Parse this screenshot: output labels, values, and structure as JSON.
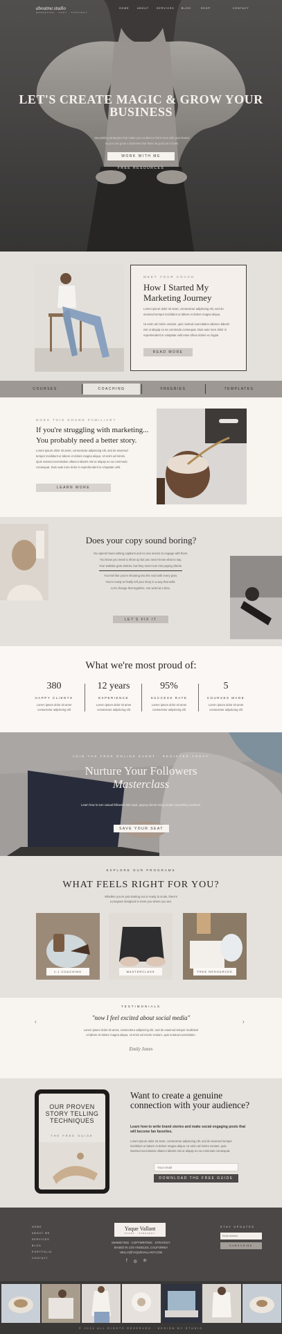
{
  "nav": {
    "brand": "aboutme.studio",
    "brand_sub": "MARKETING · COPY · STRATEGY",
    "items": [
      "HOME",
      "ABOUT",
      "SERVICES",
      "BLOG",
      "SHOP",
      "CONTACT"
    ]
  },
  "hero": {
    "title": "LET'S CREATE MAGIC & GROW YOUR BUSINESS",
    "lines": [
      "Storytelling strategies that make your audience fall in love with your brand,",
      "so you can grow a business that feels as good as it looks."
    ],
    "button_primary": "WORK WITH ME",
    "button_secondary": "FREE RESOURCES"
  },
  "story": {
    "eyebrow": "MEET YOUR COACH",
    "title": "How I Started My Marketing Journey",
    "para1": [
      "Lorem ipsum dolor sit amet, consectetur adipiscing elit, sed do",
      "eiusmod tempor incididunt ut labore et dolore magna aliqua."
    ],
    "para2": [
      "Ut enim ad minim veniam, quis nostrud exercitation ullamco laboris",
      "nisi ut aliquip ex ea commodo consequat. Duis aute irure dolor in",
      "reprehenderit in voluptate velit esse cillum dolore eu fugiat."
    ],
    "button": "READ MORE"
  },
  "barnav": {
    "tabs": [
      "COURSES",
      "COACHING",
      "FREEBIES",
      "TEMPLATES"
    ]
  },
  "struggle": {
    "eyebrow": "DOES THIS SOUND FAMILIAR?",
    "title_line1": "If you're struggling with marketing...",
    "title_line2": "You probably need a better story.",
    "lines": [
      "Lorem ipsum dolor sit amet, consectetur adipiscing elit, sed do eiusmod",
      "tempor incididunt ut labore et dolore magna aliqua. Ut enim ad minim.",
      "Quis nostrud exercitation ullamco laboris nisi ut aliquip ex ea commodo",
      "consequat. Duis aute irure dolor in reprehenderit in voluptate velit."
    ],
    "button": "LEARN MORE"
  },
  "boring": {
    "title": "Does your copy sound boring?",
    "lines": [
      "You spend hours writing captions and no one seems to engage with them.",
      "You know you need to show up but you never know what to say.",
      "Your website gets visitors, but they never turn into paying clients.",
      "You feel like you're shouting into the void with every post.",
      "You're ready to finally tell your story in a way that sells.",
      "Let's change that together, one word at a time."
    ],
    "button": "LET'S FIX IT"
  },
  "proud": {
    "title": "What we're most proud of:",
    "stats": [
      {
        "num": "380",
        "label": "HAPPY CLIENTS",
        "desc": [
          "Lorem ipsum dolor sit amet",
          "consectetur adipiscing elit"
        ]
      },
      {
        "num": "12 years",
        "label": "EXPERIENCE",
        "desc": [
          "Lorem ipsum dolor sit amet",
          "consectetur adipiscing elit"
        ]
      },
      {
        "num": "95%",
        "label": "SUCCESS RATE",
        "desc": [
          "Lorem ipsum dolor sit amet",
          "consectetur adipiscing elit"
        ]
      },
      {
        "num": "5",
        "label": "COURSES MADE",
        "desc": [
          "Lorem ipsum dolor sit amet",
          "consectetur adipiscing elit"
        ]
      }
    ]
  },
  "master": {
    "eyebrow": "JOIN THE FREE ONLINE EVENT · REGISTER TODAY",
    "title_line1": "Nurture Your Followers",
    "title_line2": "Masterclass",
    "line": "Learn how to turn casual followers into loyal, paying clients using simple storytelling methods.",
    "button": "SAVE YOUR SEAT"
  },
  "programs": {
    "eyebrow": "EXPLORE OUR PROGRAMS",
    "title": "WHAT FEELS RIGHT FOR YOU?",
    "lines": [
      "Whether you're just starting out or ready to scale, there's",
      "a program designed to meet you where you are."
    ],
    "cards": [
      "1:1 COACHING",
      "MASTERCLASS",
      "FREE RESOURCES"
    ]
  },
  "testi": {
    "eyebrow": "TESTIMONIALS",
    "quote": "\"now I feel excited about social media\"",
    "lines": [
      "Lorem ipsum dolor sit amet, consectetur adipiscing elit, sed do eiusmod tempor incididunt",
      "ut labore et dolore magna aliqua. Ut enim ad minim veniam, quis nostrud exercitation."
    ],
    "signature": "Emily Jones",
    "prev": "‹",
    "next": "›"
  },
  "freebie": {
    "tablet_title": "OUR PROVEN STORY TELLING TECHNIQUES",
    "tablet_sub": "THE FREE GUIDE",
    "title": "Want to create a genuine connection with your audience?",
    "subtitle": "Learn how to write brand stories and make social engaging posts that will become fan favorites.",
    "lines": [
      "Lorem ipsum dolor sit amet, consectetur adipiscing elit, sed do eiusmod tempor",
      "incididunt ut labore et dolore magna aliqua. Ut enim ad minim veniam, quis.",
      "Nostrud exercitation ullamco laboris nisi ut aliquip ex ea commodo consequat."
    ],
    "input_placeholder": "Your email",
    "button": "DOWNLOAD THE FREE GUIDE"
  },
  "footer": {
    "links": [
      "HOME",
      "ABOUT ME",
      "SERVICES",
      "BLOG",
      "PORTFOLIO",
      "CONTACT"
    ],
    "logo": "Yaque Vallant",
    "logo_sub": "STORY · STRATEGY",
    "center_lines": [
      "MARKETING · COPYWRITING · STRATEGY",
      "BASED IN LOS ANGELES, CALIFORNIA",
      "HELLO@YAQUEVALLANT.COM"
    ],
    "newsletter_title": "STAY UPDATED",
    "newsletter_placeholder": "Email address",
    "newsletter_button": "SUBSCRIBE",
    "copyright": "© 2024 ALL RIGHTS RESERVED · DESIGN BY STUDIO"
  },
  "colors": {
    "dark": "#4a4746",
    "beige": "#e4e1dd",
    "cream": "#f8f4f0",
    "accent": "#a39d98"
  }
}
